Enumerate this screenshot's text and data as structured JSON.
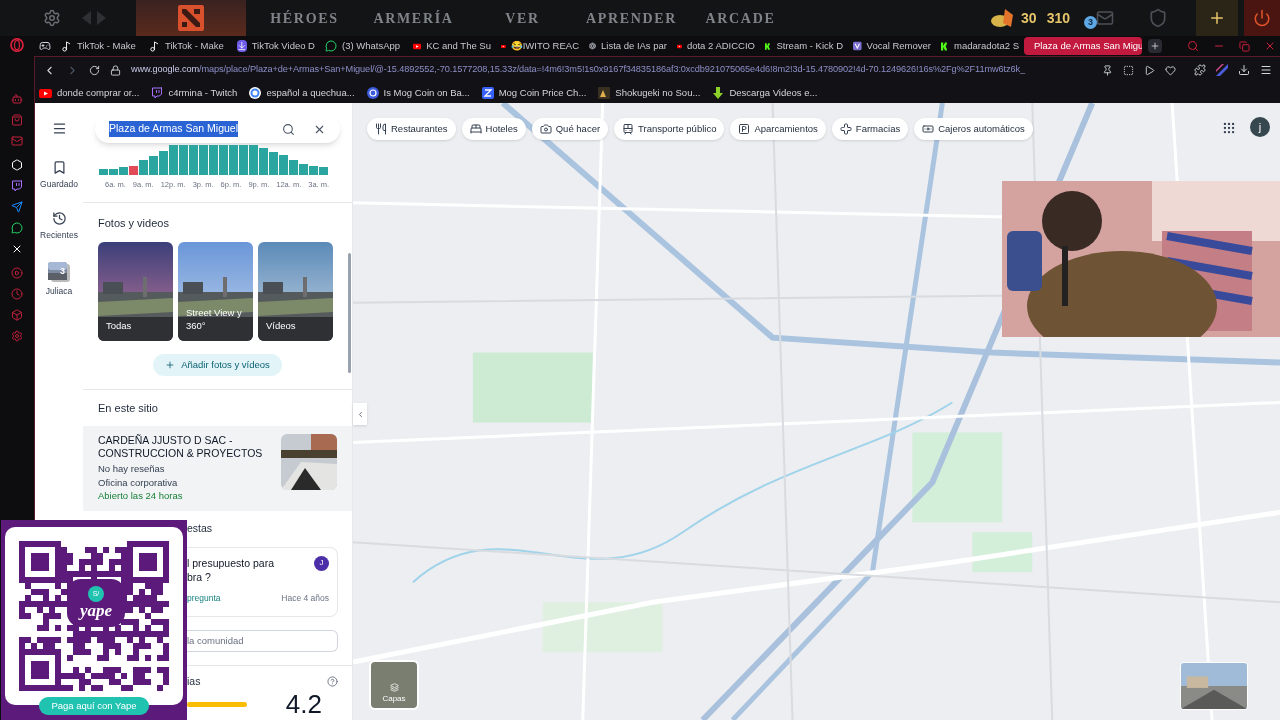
{
  "game_bar": {
    "nav": [
      "HÉROES",
      "ARMERÍA",
      "VER",
      "APRENDER",
      "ARCADE"
    ],
    "currency": [
      "30",
      "310"
    ],
    "mail_badge": "3"
  },
  "browser": {
    "tabs": [
      {
        "kind": "gamepad",
        "selected": false
      },
      {
        "kind": "tiktok",
        "title": "TikTok - Make",
        "selected": false
      },
      {
        "kind": "tiktok",
        "title": "TikTok - Make",
        "selected": false
      },
      {
        "kind": "download",
        "title": "TikTok Video D",
        "selected": false
      },
      {
        "kind": "whatsapp",
        "title": "(3) WhatsApp",
        "selected": false
      },
      {
        "kind": "youtube",
        "title": "KC and The Su",
        "selected": false
      },
      {
        "kind": "youtube",
        "title": "😂IWITO REAC",
        "selected": false
      },
      {
        "kind": "aperture",
        "title": "Lista de IAs par",
        "selected": false
      },
      {
        "kind": "youtube",
        "title": "dota 2 ADICCIO",
        "selected": false
      },
      {
        "kind": "kick",
        "title": "Stream - Kick D",
        "selected": false
      },
      {
        "kind": "vocal",
        "title": "Vocal Remover",
        "selected": false
      },
      {
        "kind": "kick",
        "title": "madaradota2 S",
        "selected": false
      },
      {
        "kind": "maps",
        "title": "Plaza de Armas San Migu",
        "selected": true
      }
    ],
    "url_host": "www.google.com",
    "url_path": "/maps/place/Plaza+de+Armas+San+Miguel/@-15.4892552,-70.1577208,15.33z/data=!4m6!3m5!1s0x9167f34835186af3:0xcdb921075065e4d6!8m2!3d-15.4780902!4d-70.1249626!16s%2Fg%2F11mw6tz6k_",
    "bookmarks": [
      {
        "kind": "youtube",
        "title": "donde comprar or..."
      },
      {
        "kind": "twitch",
        "title": "c4rmina - Twitch"
      },
      {
        "kind": "google",
        "title": "español a quechua..."
      },
      {
        "kind": "coin",
        "title": "Is Mog Coin on Ba..."
      },
      {
        "kind": "chart",
        "title": "Mog Coin Price Ch..."
      },
      {
        "kind": "anime",
        "title": "Shokugeki no Sou..."
      },
      {
        "kind": "arrow",
        "title": "Descarga Videos e..."
      }
    ]
  },
  "maps": {
    "search": {
      "value": "Plaza de Armas San Miguel"
    },
    "rail": [
      {
        "kind": "saved",
        "label": "Guardado"
      },
      {
        "kind": "recent",
        "label": "Recientes"
      },
      {
        "kind": "place",
        "label": "Juliaca",
        "badge": "3"
      }
    ],
    "popular_times": {
      "xlabels": [
        "6a. m.",
        "9a. m.",
        "12p. m.",
        "3p. m.",
        "6p. m.",
        "9p. m.",
        "12a. m.",
        "3a. m."
      ]
    },
    "photos": {
      "title": "Fotos y videos",
      "items": [
        {
          "label": "Todas"
        },
        {
          "label": "Street View y 360°"
        },
        {
          "label": "Vídeos"
        }
      ],
      "add_button": "Añadir fotos y vídeos"
    },
    "nearby": {
      "title": "En este sitio",
      "name": "CARDEÑA JJUSTO D SAC - CONSTRUCCION & PROYECTOS",
      "reviews": "No hay reseñas",
      "category": "Oficina corporativa",
      "hours": "Abierto las 24 horas"
    },
    "questions": {
      "title": "estas",
      "question_lines": [
        "l presupuesto para",
        "bra ?"
      ],
      "avatar": "J",
      "link": "pregunta",
      "time": "Hace 4 años",
      "field_placeholder": "la comunidad"
    },
    "reviews": {
      "title": "ias",
      "rating": "4.2"
    },
    "chips": [
      {
        "kind": "restaurant",
        "label": "Restaurantes"
      },
      {
        "kind": "hotel",
        "label": "Hoteles"
      },
      {
        "kind": "camera",
        "label": "Qué hacer"
      },
      {
        "kind": "transit",
        "label": "Transporte público"
      },
      {
        "kind": "parking",
        "label": "Aparcamientos"
      },
      {
        "kind": "pharmacy",
        "label": "Farmacias"
      },
      {
        "kind": "atm",
        "label": "Cajeros automáticos"
      }
    ],
    "account": "j",
    "layers": "Capas"
  },
  "qr": {
    "currency": "S/",
    "logo": "yape",
    "button": "Paga aquí con Yape"
  }
}
